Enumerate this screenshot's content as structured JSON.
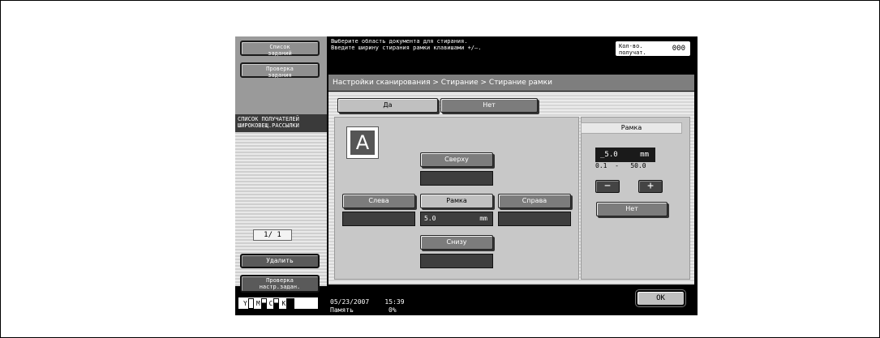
{
  "sidebar": {
    "job_list": "Список\nзаданий",
    "job_check": "Проверка\nзадания",
    "recipient_header": "СПИСОК ПОЛУЧАТЕЛЕЙ\nШИРОКОВЕЩ.РАССЫЛКИ",
    "page_indicator": "1/  1",
    "delete_label": "Удалить",
    "check_settings": "Проверка\nнастр.задан.",
    "toner": [
      "Y",
      "M",
      "C",
      "K"
    ]
  },
  "header": {
    "message": "Выберите область документа для стирания.\nВведите ширину стирания рамки клавишами +/–.",
    "counter_label": "Кол-во.\nполучат.",
    "counter_value": "000"
  },
  "breadcrumb": "Настройки сканирования > Стирание > Стирание рамки",
  "toggle": {
    "yes": "Да",
    "no": "Нет"
  },
  "positions": {
    "top": "Сверху",
    "left": "Слева",
    "frame": "Рамка",
    "right": "Справа",
    "bottom": "Снизу",
    "frame_value": "5.0",
    "unit": "mm"
  },
  "icon_letter": "A",
  "right_panel": {
    "title": "Рамка",
    "value": "_5.0",
    "unit": "mm",
    "range": "0.1  -   50.0",
    "minus": "−",
    "plus": "+",
    "none": "Нет"
  },
  "footer": {
    "datetime": "05/23/2007    15:39",
    "memory_label": "Память",
    "memory_value": "0%",
    "ok": "OK"
  }
}
